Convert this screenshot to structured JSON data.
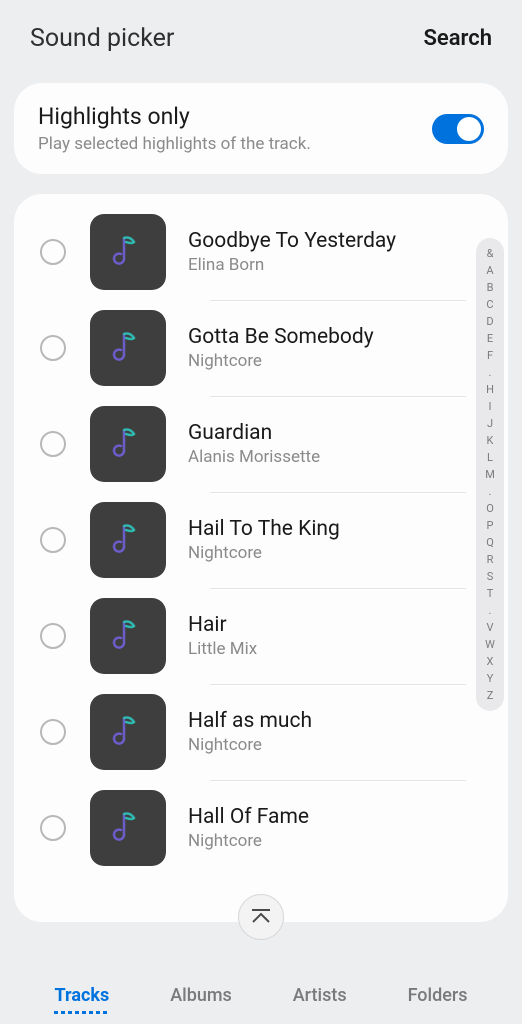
{
  "header": {
    "title": "Sound picker",
    "search": "Search"
  },
  "highlights": {
    "title": "Highlights only",
    "subtitle": "Play selected highlights of the track.",
    "enabled": true
  },
  "tracks": [
    {
      "title": "Goodbye To Yesterday",
      "artist": "Elina Born"
    },
    {
      "title": "Gotta Be Somebody",
      "artist": "Nightcore"
    },
    {
      "title": "Guardian",
      "artist": "Alanis Morissette"
    },
    {
      "title": "Hail To The King",
      "artist": "Nightcore"
    },
    {
      "title": "Hair",
      "artist": "Little Mix"
    },
    {
      "title": "Half as much",
      "artist": "Nightcore"
    },
    {
      "title": "Hall Of Fame",
      "artist": "Nightcore"
    }
  ],
  "alpha_index": [
    "&",
    "A",
    "B",
    "C",
    "D",
    "E",
    "F",
    ".",
    "H",
    "I",
    "J",
    "K",
    "L",
    "M",
    ".",
    "O",
    "P",
    "Q",
    "R",
    "S",
    "T",
    ".",
    "V",
    "W",
    "X",
    "Y",
    "Z"
  ],
  "tabs": [
    {
      "label": "Tracks",
      "active": true
    },
    {
      "label": "Albums",
      "active": false
    },
    {
      "label": "Artists",
      "active": false
    },
    {
      "label": "Folders",
      "active": false
    }
  ]
}
